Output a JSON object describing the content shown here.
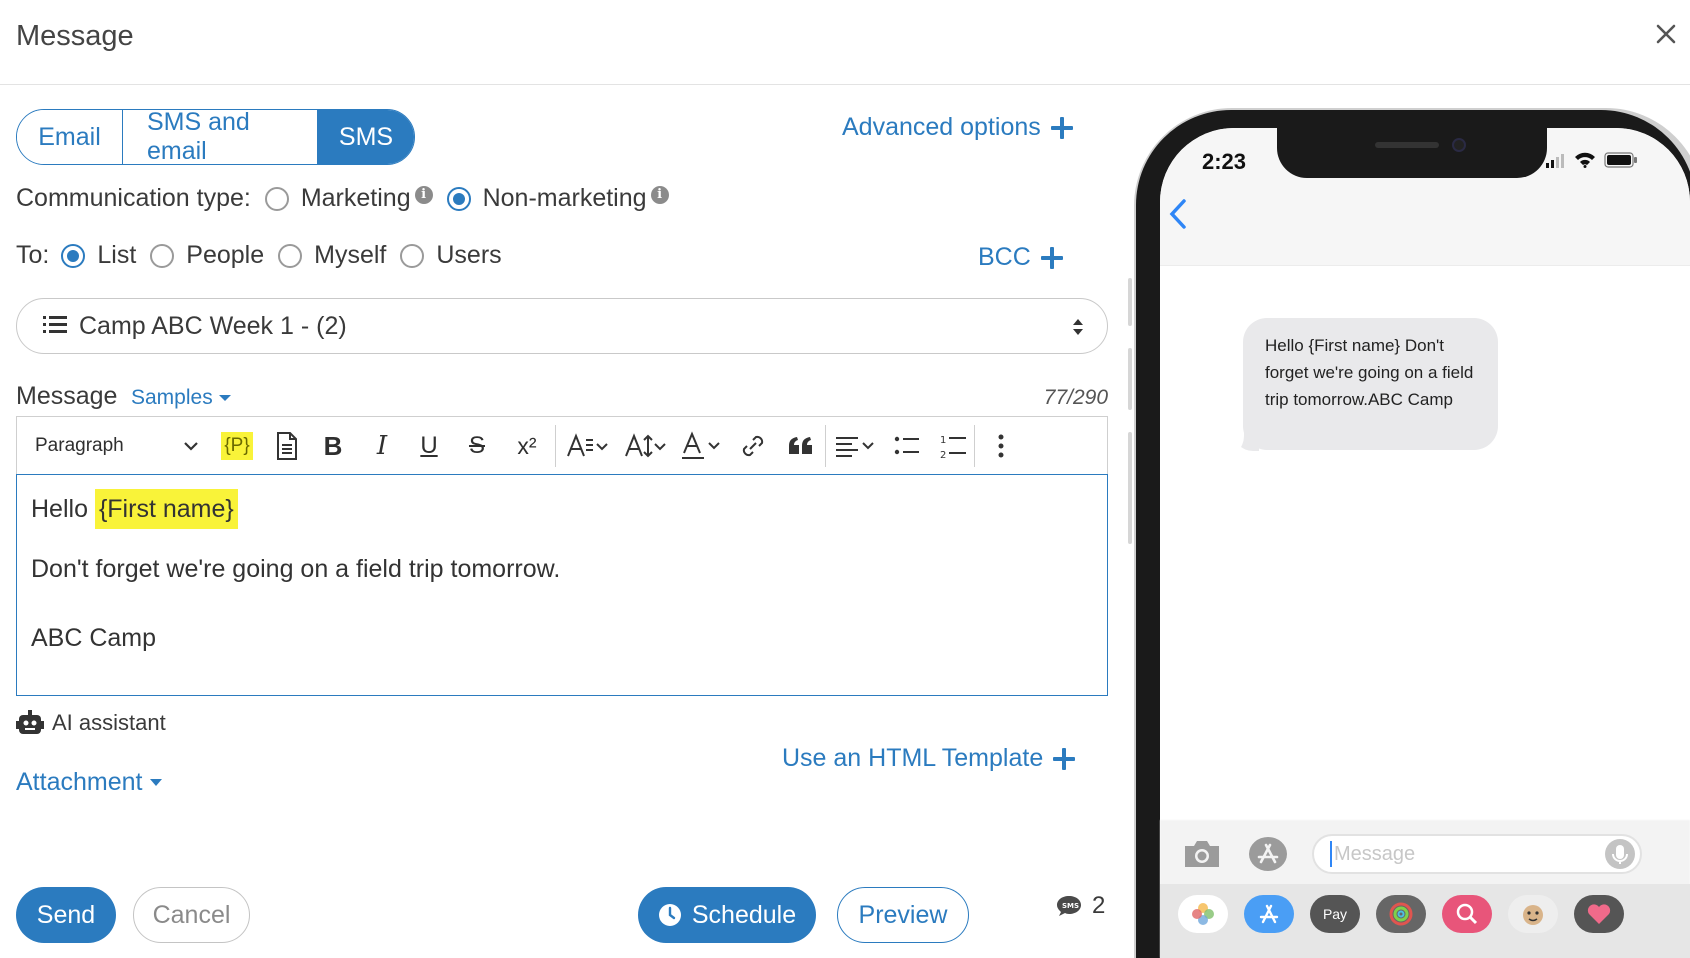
{
  "dialog": {
    "title": "Message",
    "close_icon": "close-icon"
  },
  "channel_tabs": [
    {
      "label": "Email",
      "active": false
    },
    {
      "label": "SMS and email",
      "active": false
    },
    {
      "label": "SMS",
      "active": true
    }
  ],
  "advanced_options": {
    "label": "Advanced options",
    "icon": "plus-icon"
  },
  "communication_type": {
    "label": "Communication type:",
    "options": [
      {
        "label": "Marketing",
        "selected": false,
        "icon": "info-icon"
      },
      {
        "label": "Non-marketing",
        "selected": true,
        "icon": "info-icon"
      }
    ]
  },
  "to": {
    "label": "To:",
    "options": [
      {
        "label": "List",
        "selected": true
      },
      {
        "label": "People",
        "selected": false
      },
      {
        "label": "Myself",
        "selected": false
      },
      {
        "label": "Users",
        "selected": false
      }
    ],
    "bcc_label": "BCC"
  },
  "list_select": {
    "value": "Camp ABC Week 1 - (2)",
    "icon": "list-icon"
  },
  "message": {
    "label": "Message",
    "samples_label": "Samples",
    "counter": "77/290"
  },
  "toolbar": {
    "paragraph_label": "Paragraph",
    "placeholder_label": "{P}",
    "superscript_label": "x²",
    "buttons": [
      "document-icon",
      "bold-icon",
      "italic-icon",
      "underline-icon",
      "strikethrough-icon",
      "superscript-icon",
      "font-family-icon",
      "font-size-icon",
      "font-color-icon",
      "link-icon",
      "quote-icon",
      "align-icon",
      "bulleted-list-icon",
      "numbered-list-icon",
      "more-icon"
    ]
  },
  "editor": {
    "greeting": "Hello",
    "placeholder_token": "{First name}",
    "body": "Don't forget we're going on a field trip tomorrow.",
    "signature": "ABC Camp"
  },
  "ai_assistant": {
    "label": "AI assistant",
    "icon": "robot-icon"
  },
  "attachment": {
    "label": "Attachment"
  },
  "html_template": {
    "label": "Use an HTML Template"
  },
  "actions": {
    "send": "Send",
    "cancel": "Cancel",
    "schedule": "Schedule",
    "preview": "Preview",
    "sms_count": "2"
  },
  "phone_preview": {
    "time": "2:23",
    "bubble_text": "Hello {First name} Don't forget we're going on a field trip tomorrow.ABC Camp",
    "input_placeholder": "Message",
    "app_pay_label": "Pay"
  },
  "colors": {
    "accent": "#2b7bbf",
    "highlight": "#f9f339",
    "bubble": "#e9e9eb"
  }
}
